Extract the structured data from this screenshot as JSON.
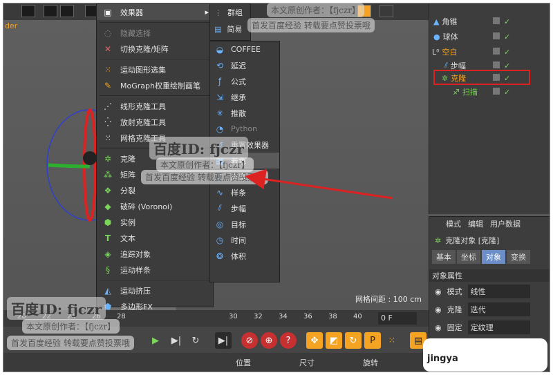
{
  "top_tab": "der",
  "menu_header": "效果器",
  "main_menu": [
    {
      "label": "隐藏选择",
      "icon": "eye-icon",
      "disabled": true
    },
    {
      "label": "切换克隆/矩阵",
      "icon": "toggle-icon"
    },
    {
      "label": "运动图形选集",
      "icon": "selection-icon"
    },
    {
      "label": "MoGraph权重绘制画笔",
      "icon": "brush-icon"
    },
    {
      "label": "线形克隆工具",
      "icon": "linear-clone-icon"
    },
    {
      "label": "放射克隆工具",
      "icon": "radial-clone-icon"
    },
    {
      "label": "网格克隆工具",
      "icon": "grid-clone-icon"
    },
    {
      "label": "克隆",
      "icon": "cloner-icon"
    },
    {
      "label": "矩阵",
      "icon": "matrix-icon"
    },
    {
      "label": "分裂",
      "icon": "fracture-icon"
    },
    {
      "label": "破碎 (Voronoi)",
      "icon": "voronoi-icon"
    },
    {
      "label": "实例",
      "icon": "instance-icon"
    },
    {
      "label": "文本",
      "icon": "text-icon"
    },
    {
      "label": "追踪对象",
      "icon": "tracer-icon"
    },
    {
      "label": "运动样条",
      "icon": "spline-icon"
    },
    {
      "label": "运动挤压",
      "icon": "extrude-icon"
    },
    {
      "label": "多边形FX",
      "icon": "polyfx-icon"
    }
  ],
  "submenu_top": [
    "群组",
    "简易"
  ],
  "submenu": [
    {
      "label": "COFFEE",
      "icon": "coffee-icon"
    },
    {
      "label": "延迟",
      "icon": "delay-icon"
    },
    {
      "label": "公式",
      "icon": "formula-icon"
    },
    {
      "label": "继承",
      "icon": "inherit-icon"
    },
    {
      "label": "推散",
      "icon": "push-apart-icon"
    },
    {
      "label": "Python",
      "icon": "python-icon",
      "disabled": true
    },
    {
      "label": "重置效果器",
      "icon": "reset-icon"
    },
    {
      "label": "着色",
      "icon": "shader-icon",
      "highlight": true
    },
    {
      "label": "声音",
      "icon": "sound-icon"
    },
    {
      "label": "样条",
      "icon": "spline-effector-icon"
    },
    {
      "label": "步幅",
      "icon": "step-icon"
    },
    {
      "label": "目标",
      "icon": "target-icon"
    },
    {
      "label": "时间",
      "icon": "time-icon"
    },
    {
      "label": "体积",
      "icon": "volume-icon"
    }
  ],
  "objects": [
    {
      "name": "角锥",
      "color": "normal",
      "icon": "pyramid-icon"
    },
    {
      "name": "球体",
      "color": "normal",
      "icon": "sphere-icon"
    },
    {
      "name": "空白",
      "color": "orange",
      "icon": "null-icon"
    },
    {
      "name": "步幅",
      "color": "normal",
      "icon": "step-icon"
    },
    {
      "name": "克隆",
      "color": "orange",
      "icon": "cloner-icon"
    },
    {
      "name": "扫描",
      "color": "green",
      "icon": "sweep-icon"
    }
  ],
  "attributes": {
    "menu": [
      "模式",
      "编辑",
      "用户数据"
    ],
    "title": "克隆对象 [克隆]",
    "tabs": [
      "基本",
      "坐标",
      "对象",
      "变换"
    ],
    "active_tab": "对象",
    "section": "对象属性",
    "fields": [
      {
        "label": "模式",
        "value": "线性"
      },
      {
        "label": "克隆",
        "value": "迭代"
      },
      {
        "label": "固定",
        "value": "定纹理"
      }
    ]
  },
  "viewport": {
    "grid_label": "网格间距 : 100 cm"
  },
  "timeline": {
    "ticks": [
      "20",
      "22",
      "24",
      "26",
      "28",
      "30",
      "32",
      "34",
      "36",
      "38",
      "40"
    ],
    "frame": "0 F"
  },
  "coords": {
    "position": "位置",
    "size": "尺寸",
    "rotation": "旋转"
  },
  "watermarks": {
    "baidu": "百度ID:",
    "id": "fjczr",
    "line1": "本文原创作者：【fjczr】",
    "line2": "首发百度经验 转载要点赞投票哦",
    "site": "jingya",
    "top_line1": "本文原创作者：【fjczr】",
    "top_line2": "首发百度经验 转载要点赞投票哦"
  },
  "colors": {
    "accent": "#f5a323",
    "highlight_box": "#dd2222",
    "active_tab": "#6a8ec5",
    "arrow": "#dd2222"
  }
}
